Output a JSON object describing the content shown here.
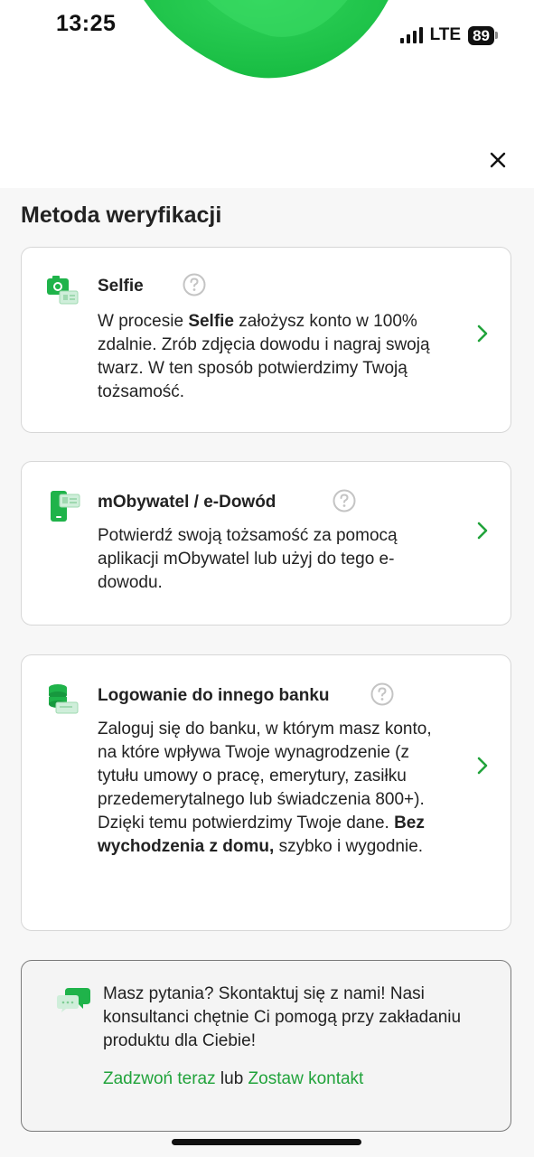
{
  "status_bar": {
    "time": "13:25",
    "network": "LTE",
    "battery": "89"
  },
  "page": {
    "title": "Metoda weryfikacji"
  },
  "options": [
    {
      "title": "Selfie",
      "desc_1": "W procesie ",
      "desc_bold": "Selfie",
      "desc_2": " założysz konto w 100% zdalnie. Zrób zdjęcia dowodu i nagraj swoją twarz. W ten sposób potwierdzimy Twoją tożsamość.",
      "icon": "camera-id-icon"
    },
    {
      "title": "mObywatel / e-Dowód",
      "desc": "Potwierdź swoją tożsamość za pomocą aplikacji mObywatel lub użyj do tego e-dowodu.",
      "icon": "phone-id-icon"
    },
    {
      "title": "Logowanie do innego banku",
      "desc_1": "Zaloguj się do banku, w którym masz konto, na które wpływa Twoje wynagrodzenie (z tytułu umowy o pracę, emerytury, zasiłku przedemerytalnego lub świadczenia 800+). Dzięki temu potwierdzimy Twoje dane. ",
      "desc_bold": "Bez wychodzenia z domu,",
      "desc_2": " szybko i wygodnie.",
      "icon": "bank-login-icon"
    }
  ],
  "contact": {
    "text": "Masz pytania? Skontaktuj się z nami! Nasi konsultanci chętnie Ci pomogą przy zakładaniu produktu dla Ciebie!",
    "call_label": "Zadzwoń teraz",
    "or_label": " lub ",
    "leave_label": "Zostaw kontakt"
  },
  "colors": {
    "accent": "#21a33b",
    "icon_green": "#1fb34a",
    "text": "#222222"
  }
}
